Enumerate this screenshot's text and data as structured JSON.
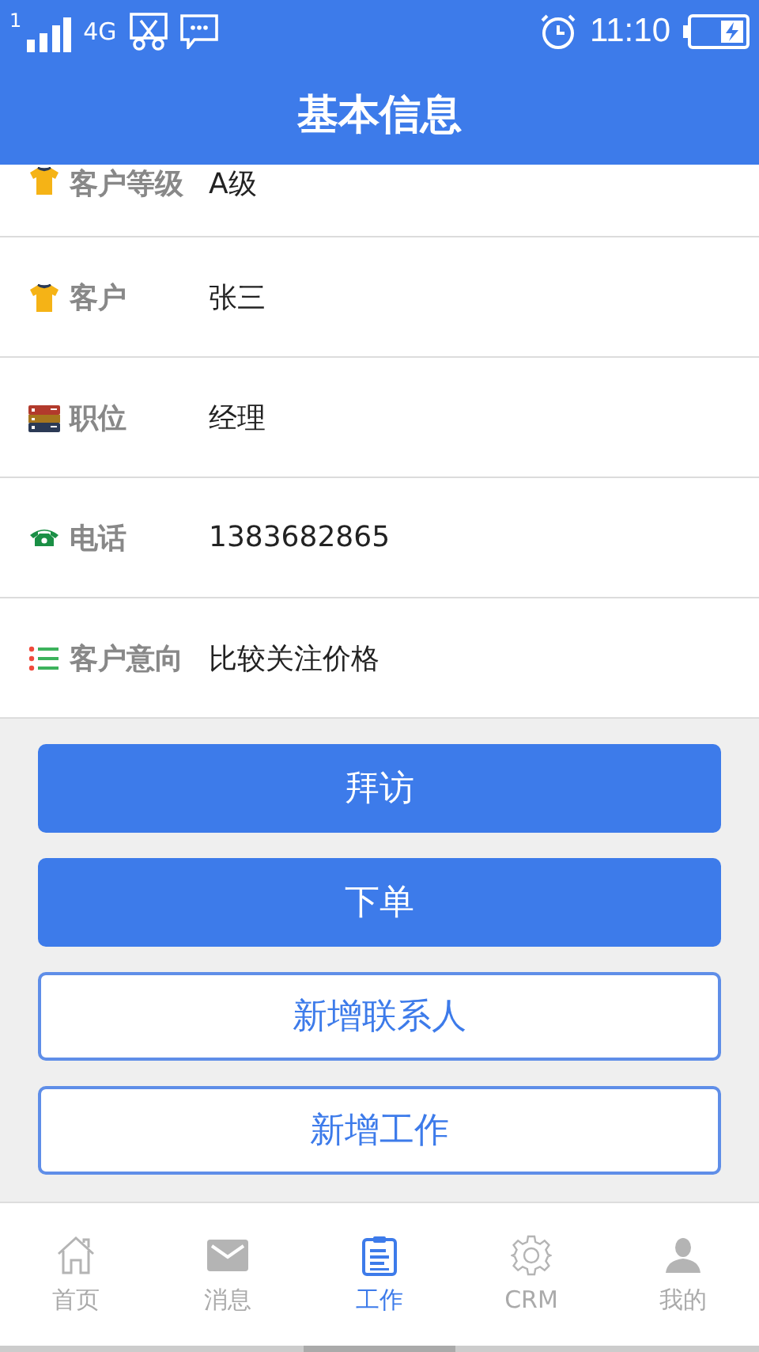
{
  "status_bar": {
    "sim": "1",
    "network": "4G",
    "time": "11:10"
  },
  "header": {
    "title": "基本信息"
  },
  "fields": [
    {
      "kind": "shirt",
      "label": "客户等级",
      "value": "A级"
    },
    {
      "kind": "shirt",
      "label": "客户",
      "value": "张三"
    },
    {
      "kind": "cabinet",
      "label": "职位",
      "value": "经理"
    },
    {
      "kind": "phone",
      "label": "电话",
      "value": "1383682865"
    },
    {
      "kind": "list",
      "label": "客户意向",
      "value": "比较关注价格"
    }
  ],
  "buttons": [
    {
      "kind": "filled",
      "label": "拜访"
    },
    {
      "kind": "filled",
      "label": "下单"
    },
    {
      "kind": "outline",
      "label": "新增联系人"
    },
    {
      "kind": "outline",
      "label": "新增工作"
    }
  ],
  "tab_bar": [
    {
      "kind": "home",
      "label": "首页",
      "selected": false
    },
    {
      "kind": "mail",
      "label": "消息",
      "selected": false
    },
    {
      "kind": "clipboard",
      "label": "工作",
      "selected": true
    },
    {
      "kind": "gear",
      "label": "CRM",
      "selected": false
    },
    {
      "kind": "person",
      "label": "我的",
      "selected": false
    }
  ]
}
